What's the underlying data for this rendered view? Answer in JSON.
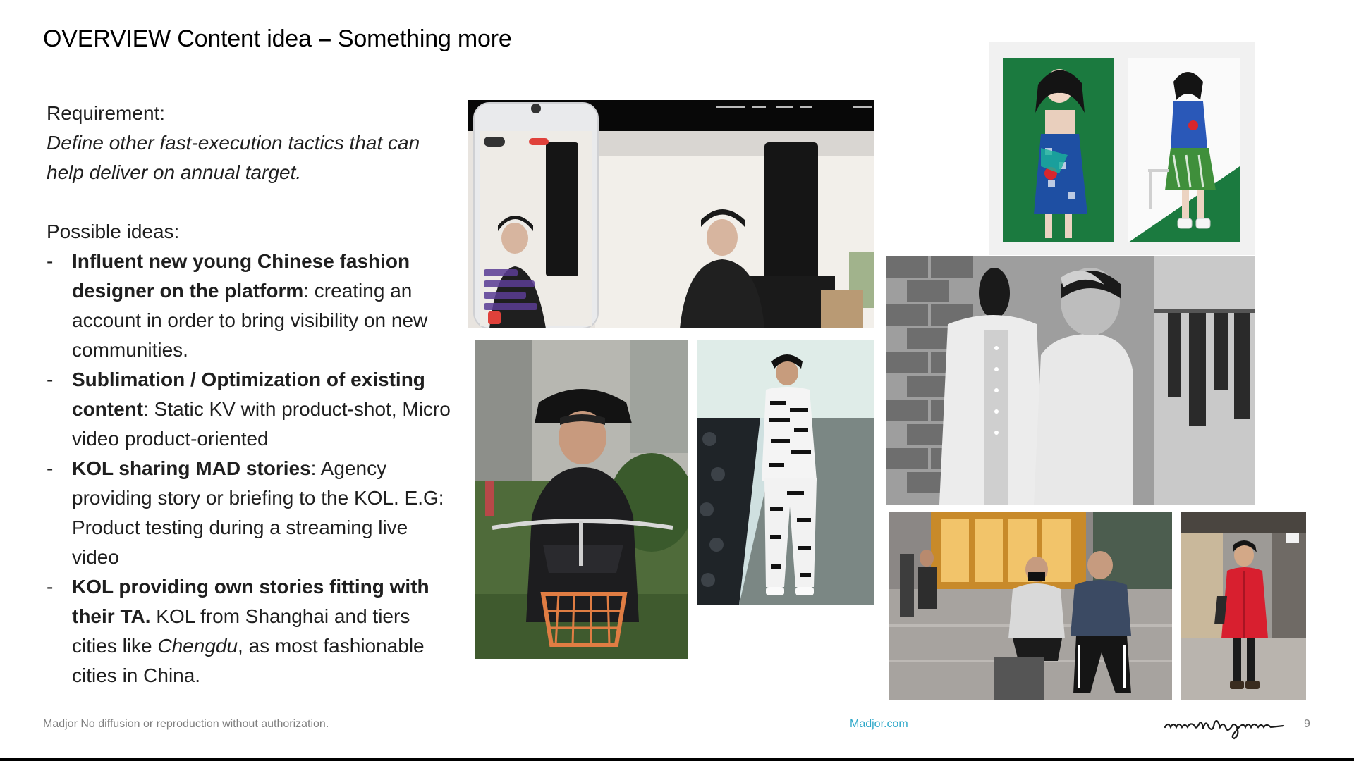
{
  "slide": {
    "title_main": "OVERVIEW Content idea ",
    "title_dash": "–",
    "title_rest": " Something more",
    "page_number": "9"
  },
  "requirement": {
    "label": "Requirement:",
    "line1": "Define other fast-execution tactics that can",
    "line2": "help deliver on annual target."
  },
  "ideas": {
    "label": "Possible ideas:",
    "bullet": "-",
    "items": [
      {
        "bold": "Influent new young Chinese fashion designer on the platform",
        "text": ": creating an account in order to bring visibility on new communities."
      },
      {
        "bold": "Sublimation / Optimization of existing content",
        "text": ": Static KV with product-shot, Micro video product-oriented"
      },
      {
        "bold": "KOL sharing MAD stories",
        "text": ": Agency providing story or briefing to the KOL. E.G: Product testing during a streaming live video"
      },
      {
        "bold": "KOL providing own stories fitting with their TA.",
        "text_a": " KOL from Shanghai and tiers cities like ",
        "text_city": "Chengdu",
        "text_b": ", as most fashionable cities in China."
      }
    ]
  },
  "footer": {
    "disclaimer": "Madjor No diffusion or reproduction without authorization.",
    "link": "Madjor.com",
    "logo_text": "maulignac"
  },
  "colors": {
    "link": "#2ea8c9",
    "footer_text": "#7f7f7f",
    "green_backdrop": "#1b7a3f"
  }
}
